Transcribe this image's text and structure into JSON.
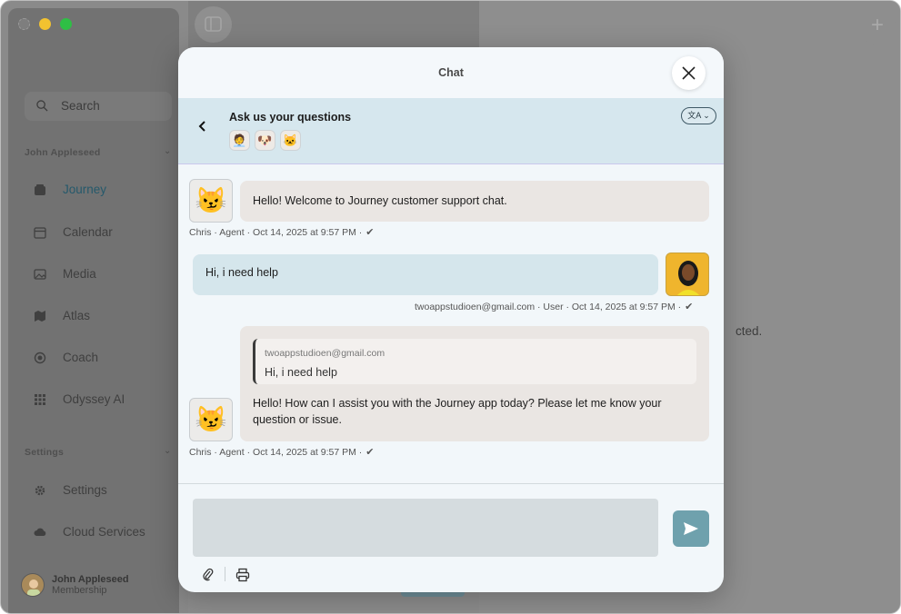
{
  "sidebar": {
    "search_placeholder": "Search",
    "section_user": "John Appleseed",
    "items": [
      {
        "label": "Journey",
        "icon": "journey-icon"
      },
      {
        "label": "Calendar",
        "icon": "calendar-icon"
      },
      {
        "label": "Media",
        "icon": "media-icon"
      },
      {
        "label": "Atlas",
        "icon": "atlas-map-icon"
      },
      {
        "label": "Coach",
        "icon": "coach-icon"
      },
      {
        "label": "Odyssey AI",
        "icon": "grid-icon"
      }
    ],
    "section_settings": "Settings",
    "settings_items": [
      {
        "label": "Settings",
        "icon": "gear-icon"
      },
      {
        "label": "Cloud Services",
        "icon": "cloud-icon"
      }
    ],
    "profile": {
      "name": "John Appleseed",
      "subtitle": "Membership"
    }
  },
  "background": {
    "hint_text": "cted."
  },
  "chat": {
    "title": "Chat",
    "banner_title": "Ask us your questions",
    "translate_icon": "translate-icon",
    "agent_emojis": [
      "🧑‍💼",
      "🐶",
      "🐱"
    ],
    "messages": [
      {
        "role": "agent",
        "avatar": "😼",
        "text": "Hello! Welcome to Journey customer support chat.",
        "meta": "Chris · Agent · Oct 14, 2025 at 9:57 PM ·"
      },
      {
        "role": "user",
        "text": "Hi, i need help",
        "meta": "twoappstudioen@gmail.com · User · Oct 14, 2025 at 9:57 PM ·"
      },
      {
        "role": "agent",
        "avatar": "😼",
        "quote_author": "twoappstudioen@gmail.com",
        "quote_text": "Hi, i need help",
        "text": "Hello! How can I assist you with the Journey app today? Please let me know your question or issue.",
        "meta": "Chris · Agent · Oct 14, 2025 at 9:57 PM ·"
      }
    ],
    "input_value": "",
    "input_placeholder": ""
  },
  "colors": {
    "accent": "#6fa1ad",
    "banner": "#d6e7ee",
    "agent_bubble": "#eae6e3",
    "user_bubble": "#d5e6ec"
  }
}
